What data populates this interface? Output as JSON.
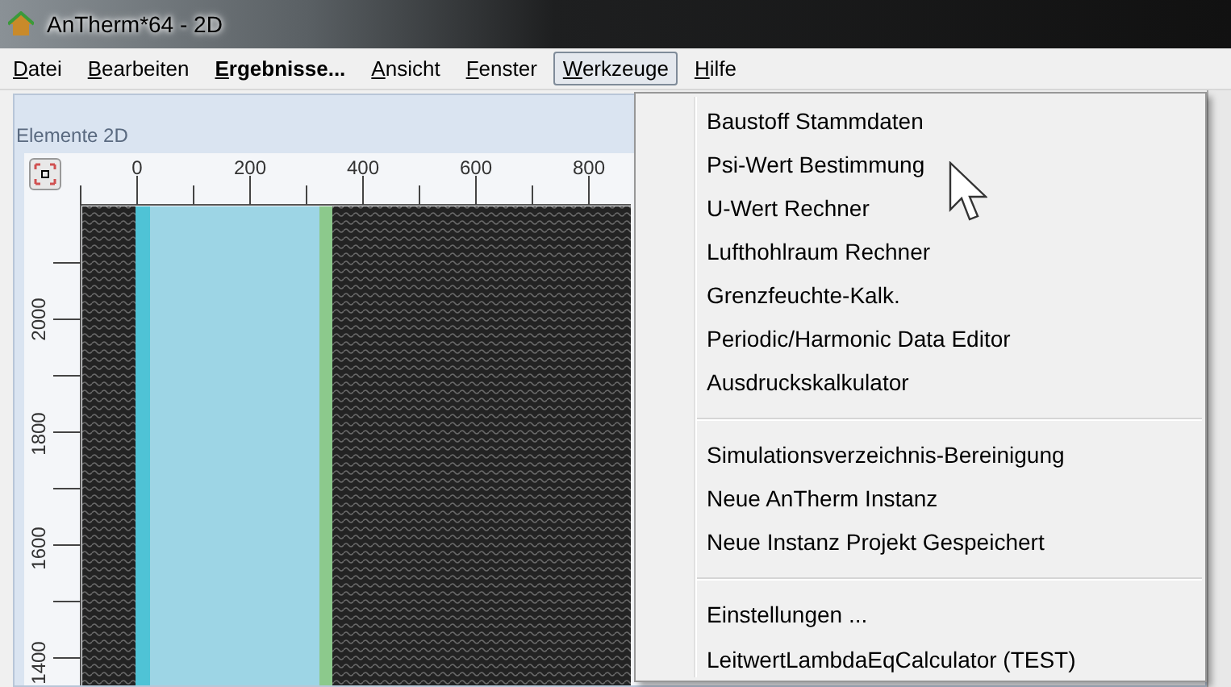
{
  "window": {
    "title": "AnTherm*64 - 2D"
  },
  "menu_bar": [
    {
      "label": "Datei",
      "bold": false,
      "selected": false
    },
    {
      "label": "Bearbeiten",
      "bold": false,
      "selected": false
    },
    {
      "label": "Ergebnisse...",
      "bold": true,
      "selected": false
    },
    {
      "label": "Ansicht",
      "bold": false,
      "selected": false
    },
    {
      "label": "Fenster",
      "bold": false,
      "selected": false
    },
    {
      "label": "Werkzeuge",
      "bold": false,
      "selected": true
    },
    {
      "label": "Hilfe",
      "bold": false,
      "selected": false
    }
  ],
  "panel": {
    "title": "Elemente 2D",
    "x_ruler": [
      "0",
      "200",
      "400",
      "600",
      "800"
    ],
    "y_ruler": [
      "2000",
      "1800",
      "1600",
      "1400"
    ]
  },
  "dropdown": {
    "groups": [
      {
        "items": [
          "Baustoff Stammdaten",
          "Psi-Wert Bestimmung",
          "U-Wert Rechner",
          "Lufthohlraum Rechner",
          "Grenzfeuchte-Kalk.",
          "Periodic/Harmonic Data Editor",
          "Ausdruckskalkulator"
        ]
      },
      {
        "items": [
          "Simulationsverzeichnis-Bereinigung",
          "Neue AnTherm Instanz",
          "Neue Instanz Projekt Gespeichert"
        ]
      },
      {
        "items": [
          "Einstellungen ...",
          "LeitwertLambdaEqCalculator (TEST)"
        ]
      }
    ]
  }
}
